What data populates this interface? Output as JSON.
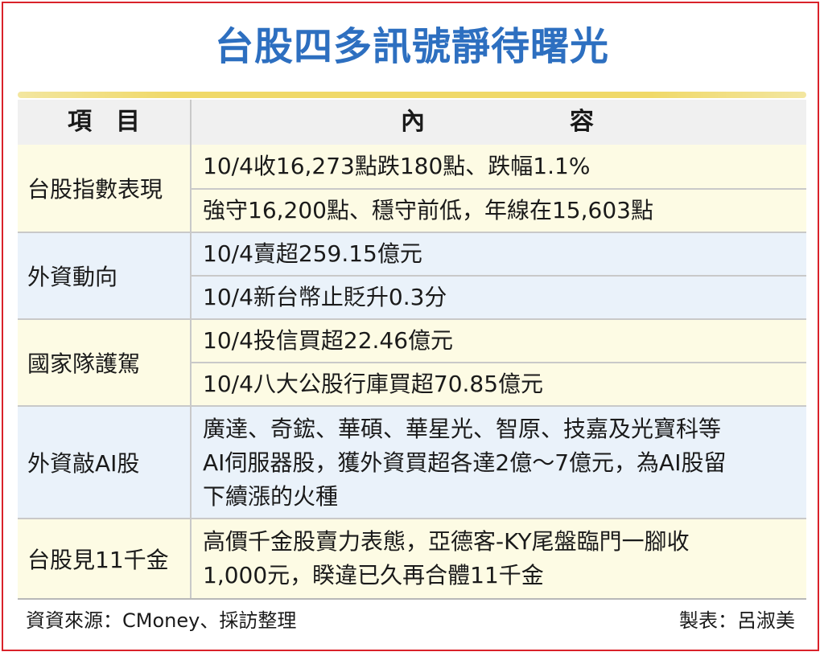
{
  "title": "台股四多訊號靜待曙光",
  "header": {
    "item": "項　目",
    "content_a": "內",
    "content_b": "容"
  },
  "rows": [
    {
      "item": "台股指數表現",
      "lines": [
        "10/4收16,273點跌180點、跌幅1.1%",
        "強守16,200點、穩守前低，年線在15,603點"
      ]
    },
    {
      "item": "外資動向",
      "lines": [
        "10/4賣超259.15億元",
        "10/4新台幣止貶升0.3分"
      ]
    },
    {
      "item": "國家隊護駕",
      "lines": [
        "10/4投信買超22.46億元",
        "10/4八大公股行庫買超70.85億元"
      ]
    },
    {
      "item": "外資敲AI股",
      "lines": [
        "廣達、奇鋐、華碩、華星光、智原、技嘉及光寶科等",
        "AI伺服器股，獲外資買超各達2億～7億元，為AI股留",
        "下續漲的火種"
      ]
    },
    {
      "item": "台股見11千金",
      "lines": [
        "高價千金股賣力表態，亞德客-KY尾盤臨門一腳收",
        "1,000元，睽違已久再合體11千金"
      ]
    }
  ],
  "footer": {
    "source": "資資來源：CMoney、採訪整理",
    "maker": "製表：呂淑美"
  },
  "colors": {
    "title": "#2d6fc0",
    "frame": "#d9222a",
    "yellow_band": "#fdfbe4",
    "blue_band": "#eaf2fa"
  }
}
